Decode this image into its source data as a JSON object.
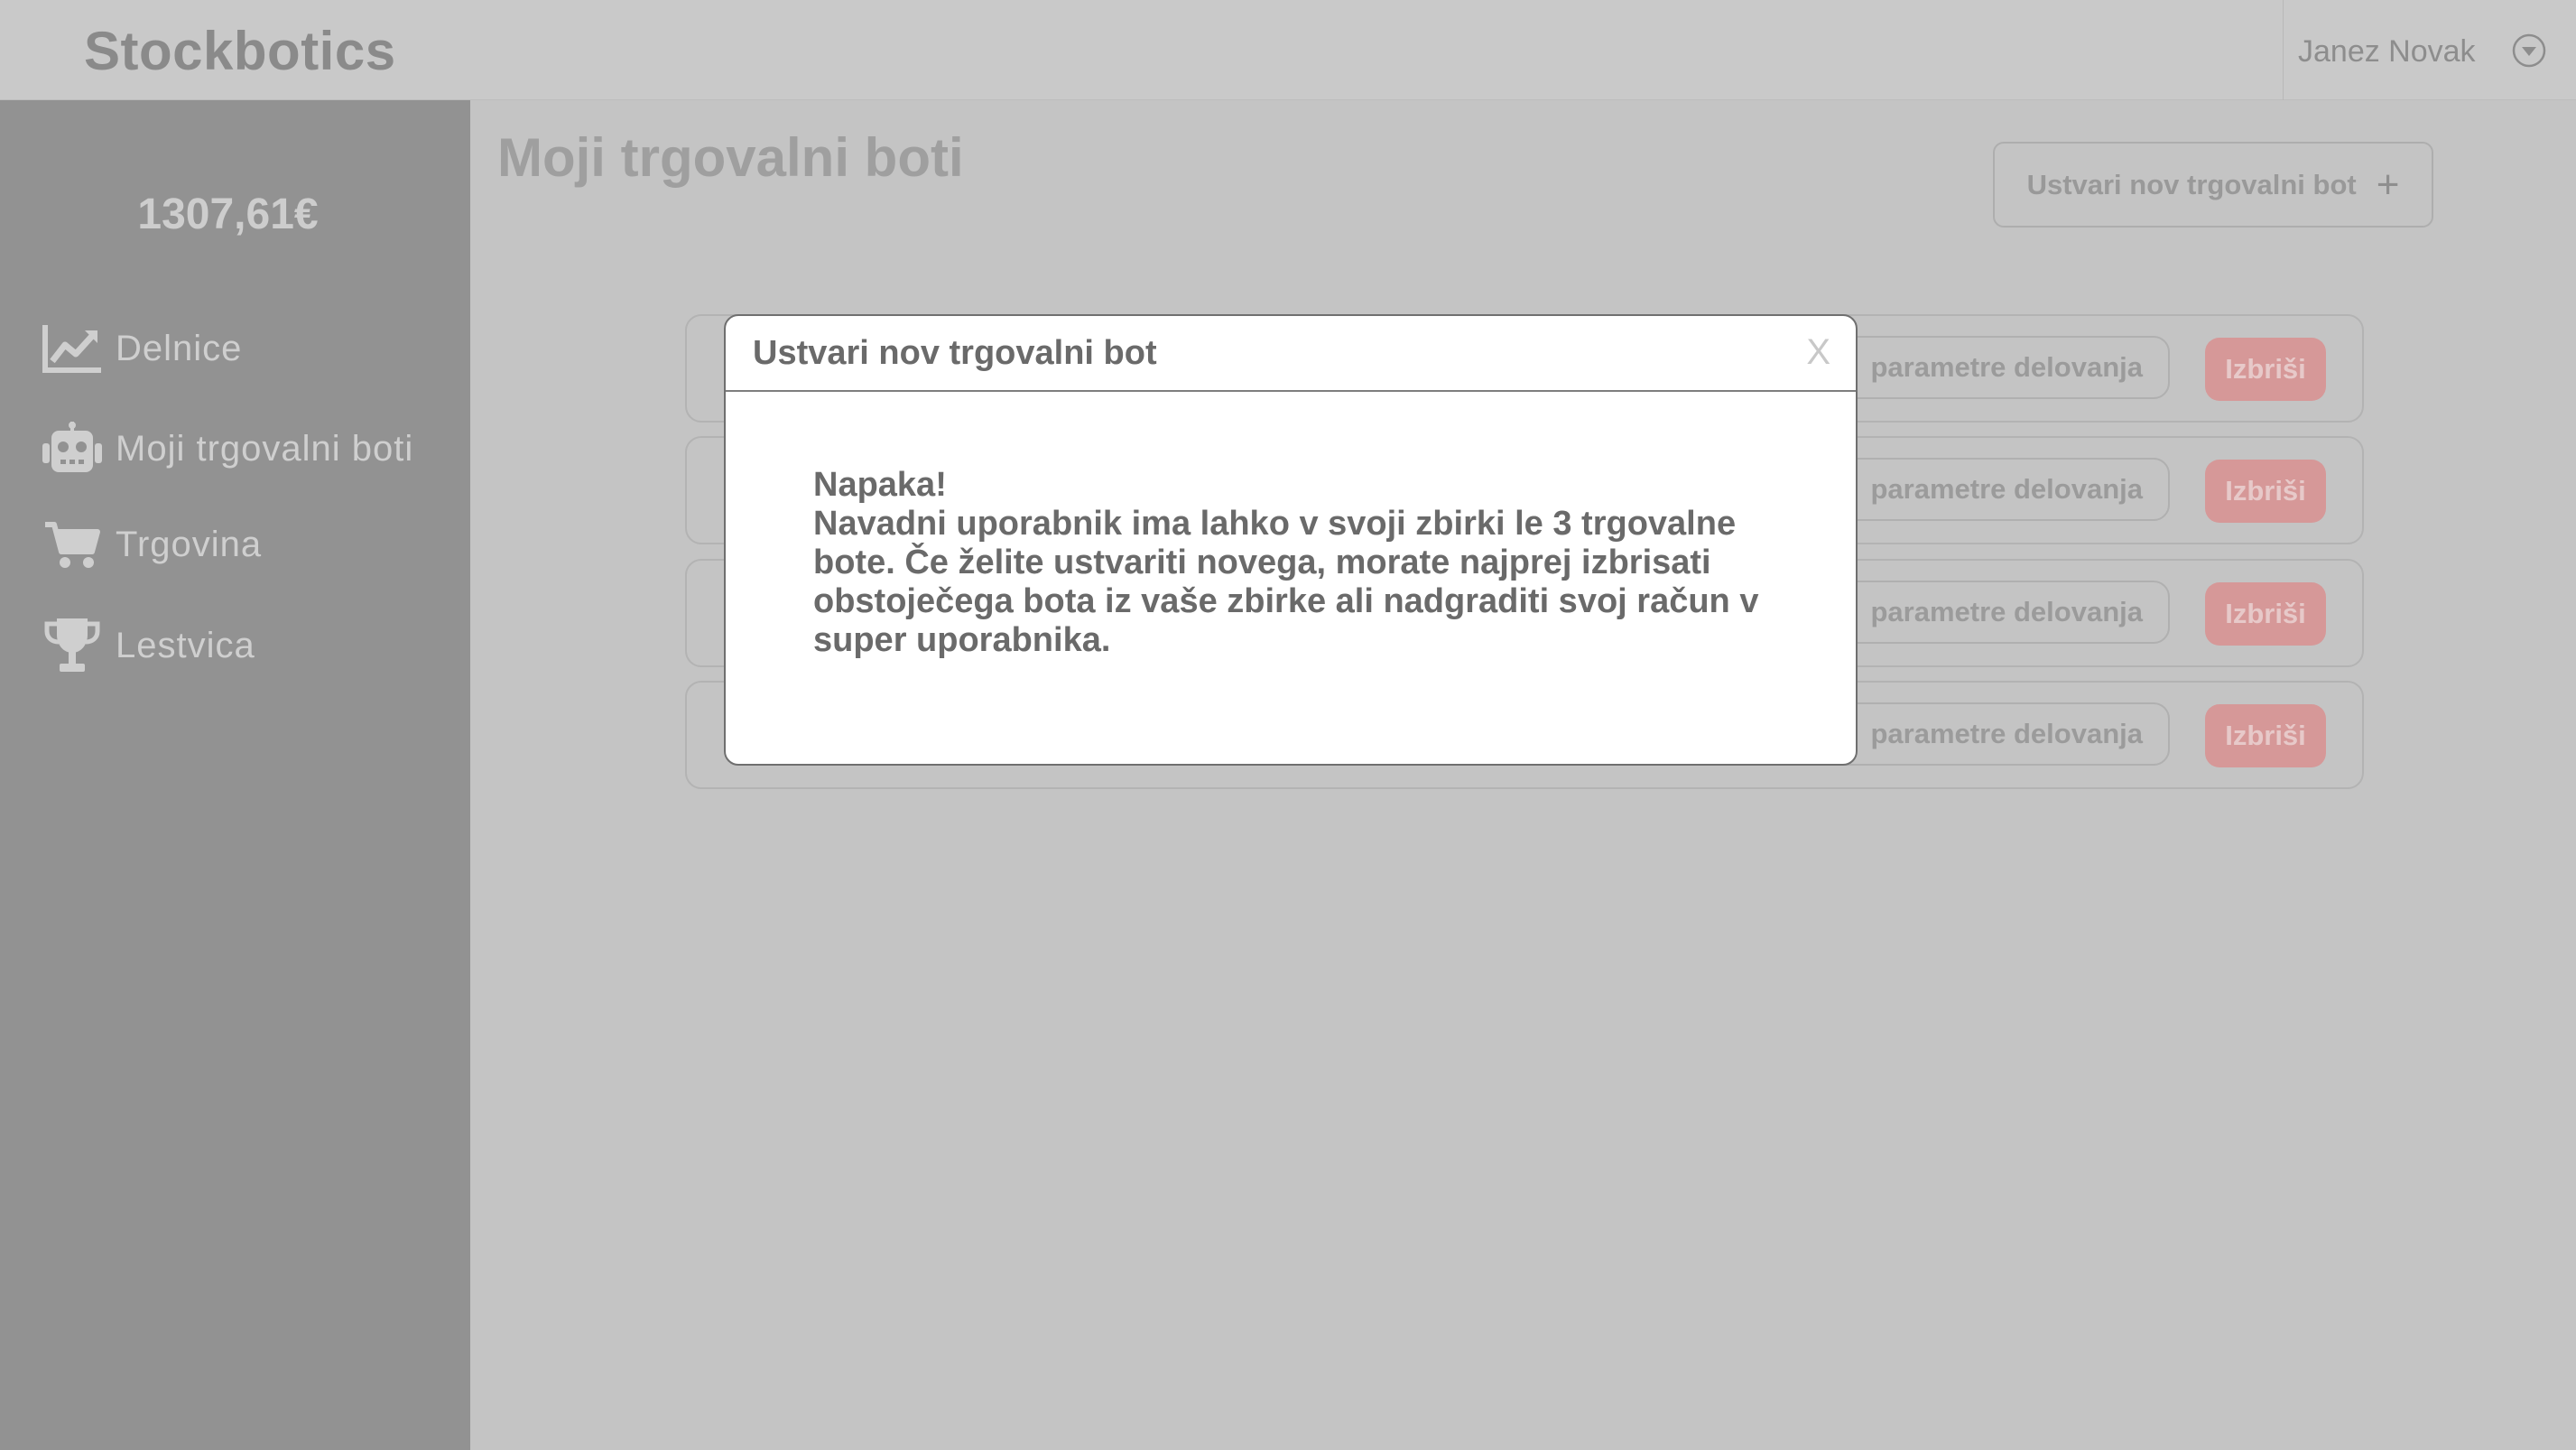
{
  "header": {
    "brand": "Stockbotics",
    "user_name": "Janez Novak"
  },
  "sidebar": {
    "balance": "1307,61€",
    "items": [
      {
        "label": "Delnice",
        "icon": "chart-line-icon"
      },
      {
        "label": "Moji trgovalni boti",
        "icon": "robot-icon"
      },
      {
        "label": "Trgovina",
        "icon": "cart-icon"
      },
      {
        "label": "Lestvica",
        "icon": "trophy-icon"
      }
    ]
  },
  "main": {
    "title": "Moji trgovalni boti",
    "create_button": "Ustvari nov trgovalni bot",
    "create_icon": "+",
    "rows": [
      {
        "param_label": "parametre delovanja",
        "delete_label": "Izbriši"
      },
      {
        "param_label": "parametre delovanja",
        "delete_label": "Izbriši"
      },
      {
        "param_label": "parametre delovanja",
        "delete_label": "Izbriši"
      },
      {
        "param_label": "parametre delovanja",
        "delete_label": "Izbriši"
      }
    ]
  },
  "modal": {
    "title": "Ustvari nov trgovalni bot",
    "close": "X",
    "error_title": "Napaka!",
    "error_message": "Navadni uporabnik ima lahko v svoji zbirki le 3 trgovalne bote. Če želite ustvariti novega, morate najprej izbrisati obstoječega bota iz vaše zbirke ali nadgraditi svoj račun v super uporabnika."
  },
  "colors": {
    "overlay": "#c4c4c4",
    "sidebar": "#929292",
    "delete": "#d69898"
  }
}
